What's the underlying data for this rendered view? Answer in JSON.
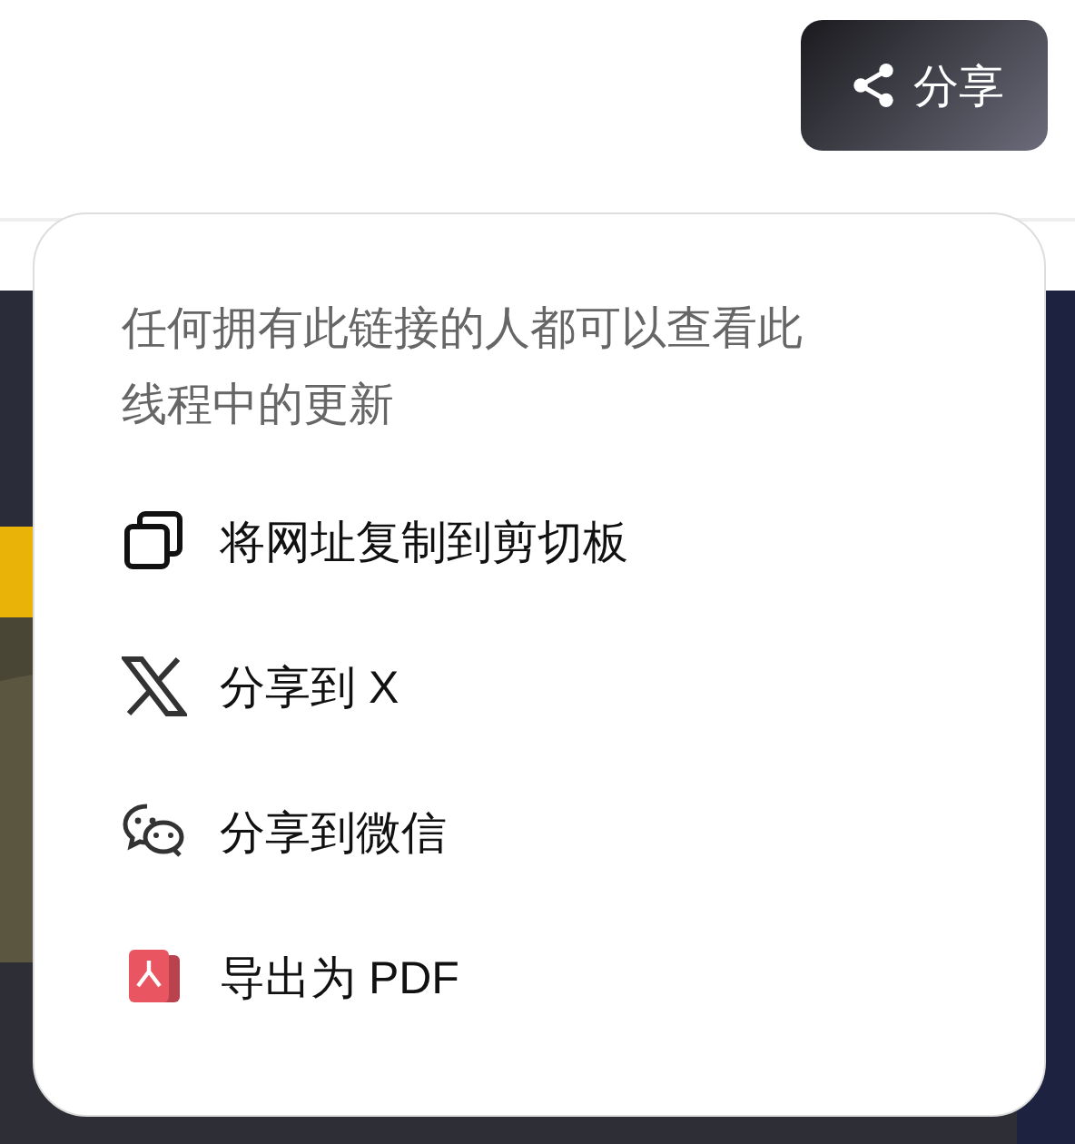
{
  "share_button": {
    "label": "分享"
  },
  "share_menu": {
    "note": "任何拥有此链接的人都可以查看此线程中的更新",
    "items": [
      {
        "kind": "copy",
        "label": "将网址复制到剪切板"
      },
      {
        "kind": "x",
        "label": "分享到 X"
      },
      {
        "kind": "wechat",
        "label": "分享到微信"
      },
      {
        "kind": "pdf",
        "label": "导出为 PDF"
      }
    ]
  }
}
